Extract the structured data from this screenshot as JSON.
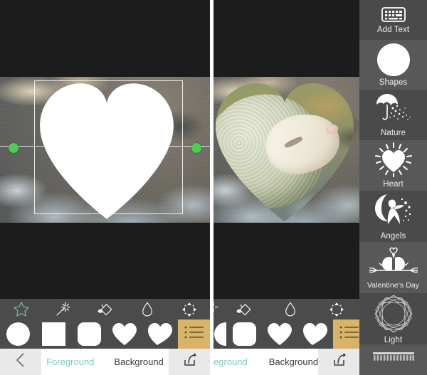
{
  "app": {
    "accent_teal": "#7ec9bd",
    "accent_gold": "#d7b469",
    "handle_green": "#4ecc54",
    "toolbar_gray": "#4b4b4b",
    "sidebar_gray": "#4d4d4d",
    "canvas_black": "#1c1c1c"
  },
  "editor": {
    "tool_strip": [
      {
        "name": "shapes-tool",
        "icon": "star-icon",
        "label": "Shapes",
        "active": true
      },
      {
        "name": "magic-tool",
        "icon": "magic-wand-icon",
        "label": "Magic",
        "active": false
      },
      {
        "name": "fill-tool",
        "icon": "paint-bucket-icon",
        "label": "Fill",
        "active": false
      },
      {
        "name": "blur-tool",
        "icon": "water-drop-icon",
        "label": "Blur",
        "active": false
      },
      {
        "name": "move-tool",
        "icon": "move-arrows-icon",
        "label": "Move",
        "active": false
      }
    ],
    "shape_strip": [
      {
        "name": "shape-circle",
        "icon": "circle-shape",
        "label": "Circle"
      },
      {
        "name": "shape-square",
        "icon": "square-shape",
        "label": "Square"
      },
      {
        "name": "shape-rounded-square",
        "icon": "rounded-square-shape",
        "label": "Rounded Square"
      },
      {
        "name": "shape-heart",
        "icon": "heart-shape",
        "label": "Heart"
      },
      {
        "name": "shape-curved-heart",
        "icon": "curved-heart-shape",
        "label": "Curved Heart"
      }
    ],
    "shape_list_button": {
      "icon": "list-icon",
      "label": "More Shapes"
    },
    "canvas": {
      "mask_shape": "heart",
      "selection_handles": 2,
      "photo_subject": "sheep"
    }
  },
  "bottom_nav": {
    "back": {
      "icon": "chevron-left-icon",
      "label": "Back"
    },
    "tabs": [
      {
        "label": "Foreground",
        "active": true
      },
      {
        "label": "Background",
        "active": false
      }
    ],
    "share": {
      "icon": "share-export-icon",
      "label": "Share"
    }
  },
  "bottom_nav_right": {
    "tabs": [
      {
        "label": "eground",
        "active": true
      },
      {
        "label": "Background",
        "active": false
      }
    ],
    "share": {
      "icon": "share-export-icon",
      "label": "Share"
    }
  },
  "sidebar": {
    "items": [
      {
        "label": "Add Text",
        "icon": "keyboard-icon"
      },
      {
        "label": "Shapes",
        "icon": "circle-icon"
      },
      {
        "label": "Nature",
        "icon": "umbrella-rain-icon"
      },
      {
        "label": "Heart",
        "icon": "shining-heart-icon"
      },
      {
        "label": "Angels",
        "icon": "fairy-moon-icon"
      },
      {
        "label": "Valentine's Day",
        "icon": "love-birds-icon"
      },
      {
        "label": "Light",
        "icon": "mandala-icon"
      },
      {
        "label": "",
        "icon": "fence-curtain-icon"
      }
    ]
  }
}
